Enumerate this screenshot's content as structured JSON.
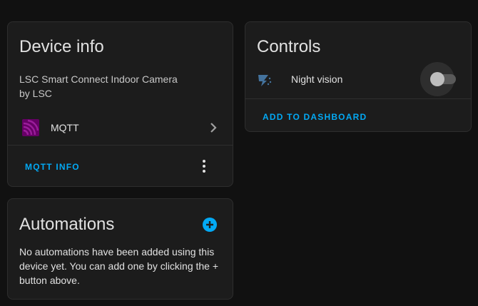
{
  "device_info": {
    "title": "Device info",
    "model": "LSC Smart Connect Indoor Camera",
    "manufacturer": "by LSC",
    "integration": {
      "label": "MQTT",
      "icon": "mqtt-icon"
    },
    "info_button": "MQTT INFO",
    "menu_icon": "more-vertical-icon"
  },
  "automations": {
    "title": "Automations",
    "add_icon": "plus-circle-icon",
    "empty_text": "No automations have been added using this device yet. You can add one by clicking the + button above."
  },
  "controls": {
    "title": "Controls",
    "entities": [
      {
        "label": "Night vision",
        "icon": "night-vision-icon",
        "state": "off"
      }
    ],
    "add_button": "ADD TO DASHBOARD"
  },
  "colors": {
    "background": "#111111",
    "card": "#1c1c1c",
    "accent": "#03a9f4",
    "mqtt": "#660066",
    "entity_icon": "#44739e"
  }
}
